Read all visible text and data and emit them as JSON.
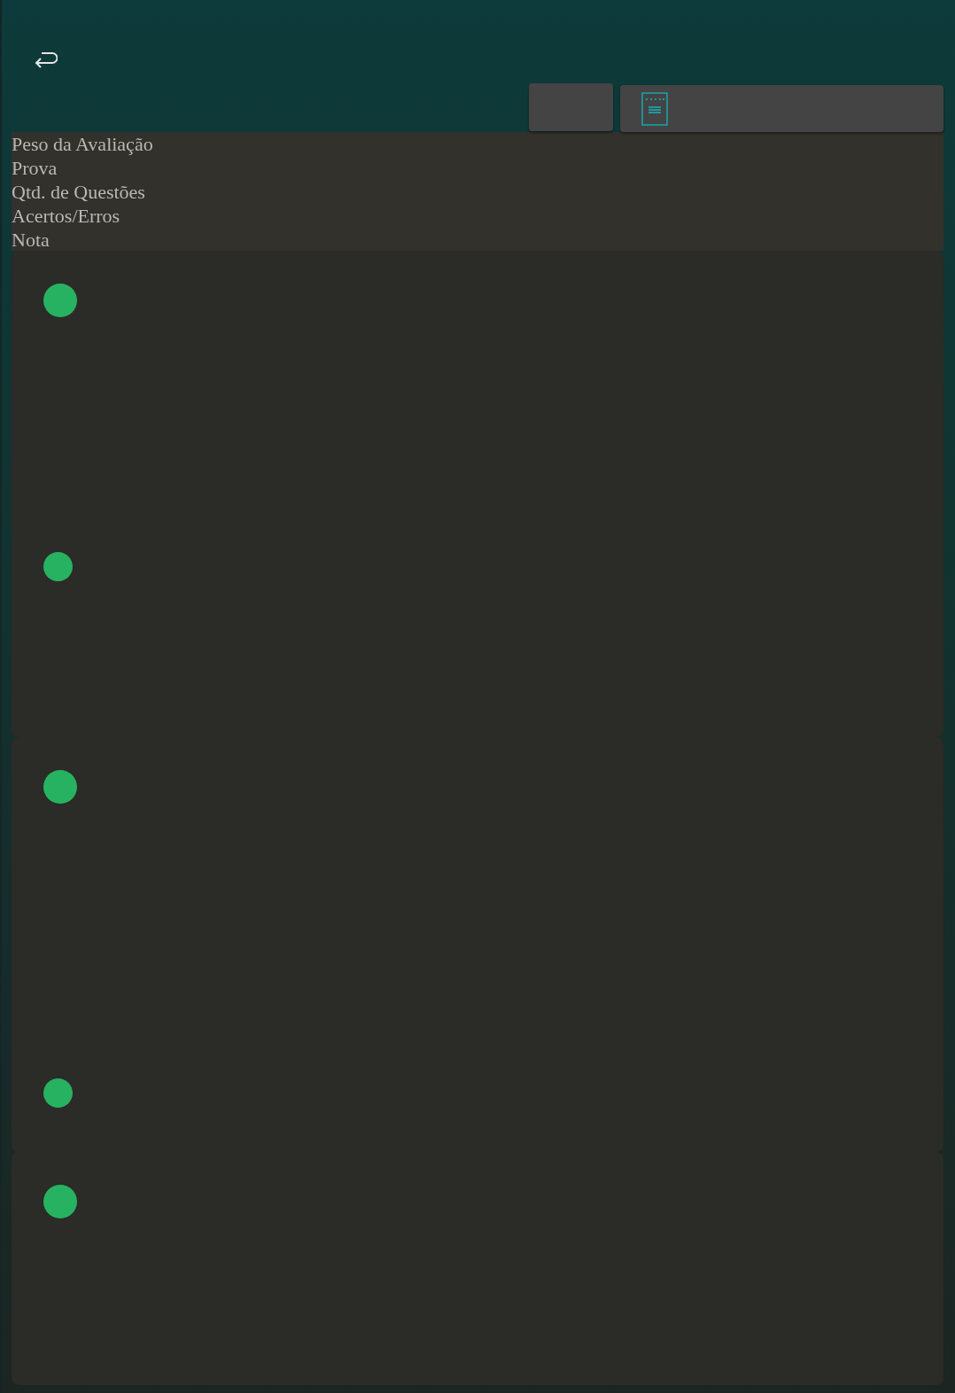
{
  "header_fields": [
    "Peso da Avaliação",
    "Prova",
    "Qtd. de Questões",
    "Acertos/Erros",
    "Nota"
  ],
  "cards": [
    {
      "kind": "tall"
    },
    {
      "kind": "medium"
    },
    {
      "kind": "short"
    }
  ]
}
